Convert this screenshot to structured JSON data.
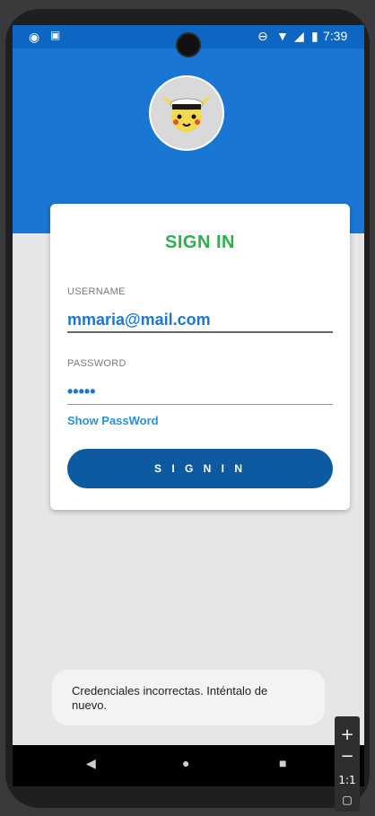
{
  "status_bar": {
    "time": "7:39"
  },
  "card": {
    "title": "SIGN IN",
    "username_label": "USERNAME",
    "username_value": "mmaria@mail.com",
    "password_label": "PASSWORD",
    "password_value": "•••••",
    "show_password": "Show PassWord",
    "signin_button": "S I G N I N"
  },
  "toast": {
    "message": "Credenciales incorrectas. Inténtalo de nuevo."
  },
  "zoom_controls": {
    "ratio": "1:1"
  },
  "colors": {
    "primary": "#1976d2",
    "title_green": "#2fae4f",
    "button_blue": "#0d5aa0",
    "input_text_blue": "#1d77d0"
  }
}
